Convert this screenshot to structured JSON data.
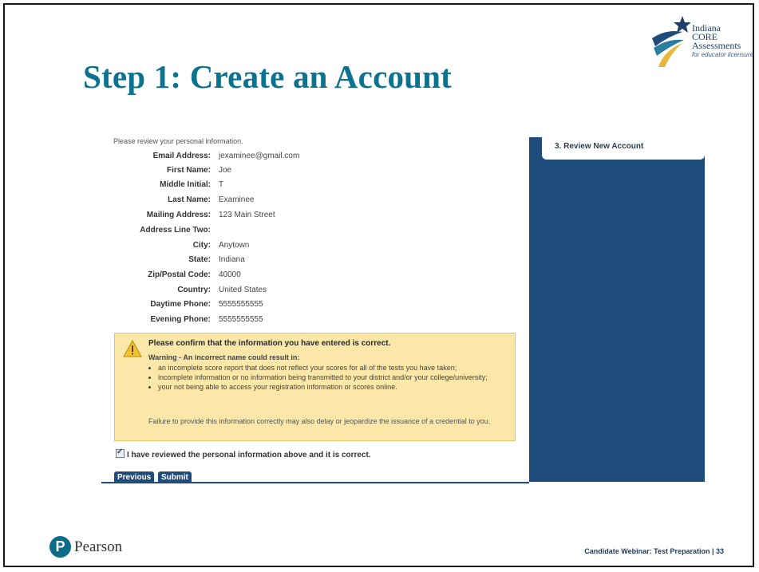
{
  "slide": {
    "title": "Step 1: Create an Account",
    "footer": "Candidate Webinar: Test Preparation | 33"
  },
  "logo": {
    "line1": "Indiana",
    "line2": "CORE",
    "line3": "Assessments",
    "line4": "for educator licensure"
  },
  "pearson": {
    "mark": "P",
    "name": "Pearson"
  },
  "form": {
    "intro": "Please review your personal information.",
    "fields": [
      {
        "label": "Email Address:",
        "value": "jexaminee@gmail.com"
      },
      {
        "label": "First Name:",
        "value": "Joe"
      },
      {
        "label": "Middle Initial:",
        "value": "T"
      },
      {
        "label": "Last Name:",
        "value": "Examinee"
      },
      {
        "label": "Mailing Address:",
        "value": "123 Main Street"
      },
      {
        "label": "Address Line Two:",
        "value": ""
      },
      {
        "label": "City:",
        "value": "Anytown"
      },
      {
        "label": "State:",
        "value": "Indiana"
      },
      {
        "label": "Zip/Postal Code:",
        "value": "40000"
      },
      {
        "label": "Country:",
        "value": "United States"
      },
      {
        "label": "Daytime Phone:",
        "value": "5555555555"
      },
      {
        "label": "Evening Phone:",
        "value": "5555555555"
      }
    ]
  },
  "warning": {
    "title": "Please confirm that the information you have entered is correct.",
    "subtitle": "Warning - An incorrect name could result in:",
    "items": [
      "an incomplete score report that does not reflect your scores for all of the tests you have taken;",
      "incomplete information or no information being transmitted to your district and/or your college/university;",
      "your not being able to access your registration information or scores online."
    ],
    "footnote": "Failure to provide this information correctly may also delay or jeopardize the issuance of a credential to you."
  },
  "confirm": {
    "label": "I have reviewed the personal information above and it is correct.",
    "checked": true
  },
  "buttons": {
    "previous": "Previous",
    "submit": "Submit"
  },
  "sidebar": {
    "step": "3.  Review New Account"
  },
  "colors": {
    "title": "#0b7390",
    "navy": "#1f4c7a",
    "warning_bg": "#fbe7a7"
  }
}
